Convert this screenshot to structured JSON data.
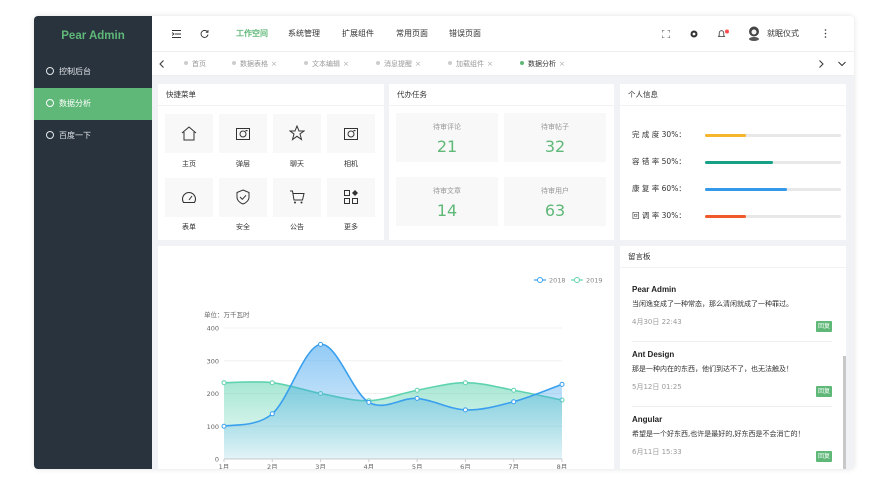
{
  "app": {
    "logo": "Pear Admin"
  },
  "sidebar": {
    "items": [
      {
        "label": "控制后台"
      },
      {
        "label": "数据分析"
      },
      {
        "label": "百度一下"
      }
    ]
  },
  "header": {
    "nav": [
      "工作空间",
      "系统管理",
      "扩展组件",
      "常用页面",
      "错误页面"
    ],
    "user": "就眠仪式",
    "icons": [
      "menu-fold-icon",
      "refresh-icon",
      "fullscreen-icon",
      "theme-icon",
      "bell-icon",
      "avatar",
      "more-icon"
    ]
  },
  "tabs": {
    "items": [
      "首页",
      "数据表格",
      "文本编辑",
      "消息提醒",
      "加载组件",
      "数据分析"
    ]
  },
  "quick_menu": {
    "title": "快捷菜单",
    "items": [
      {
        "label": "主页",
        "icon": "home-icon"
      },
      {
        "label": "弹层",
        "icon": "camera-icon"
      },
      {
        "label": "聊天",
        "icon": "star-icon"
      },
      {
        "label": "相机",
        "icon": "camera-icon"
      },
      {
        "label": "表单",
        "icon": "gauge-icon"
      },
      {
        "label": "安全",
        "icon": "shield-icon"
      },
      {
        "label": "公告",
        "icon": "cart-icon"
      },
      {
        "label": "更多",
        "icon": "apps-icon"
      }
    ]
  },
  "tasks": {
    "title": "代办任务",
    "items": [
      {
        "label": "待审评论",
        "value": "21"
      },
      {
        "label": "待审帖子",
        "value": "32"
      },
      {
        "label": "待审文章",
        "value": "14"
      },
      {
        "label": "待审用户",
        "value": "63"
      }
    ]
  },
  "profile": {
    "title": "个人信息",
    "rows": [
      {
        "label": "完 成 度 30%：",
        "value": 0.3,
        "color": "#f5b62b"
      },
      {
        "label": "容 错 率 50%：",
        "value": 0.5,
        "color": "#16a085"
      },
      {
        "label": "康 复 率 60%：",
        "value": 0.6,
        "color": "#3399e8"
      },
      {
        "label": "回 调 率 30%：",
        "value": 0.3,
        "color": "#f05a2a"
      }
    ]
  },
  "messages": {
    "title": "留言板",
    "reply_label": "回复",
    "items": [
      {
        "title": "Pear Admin",
        "content": "当闲逸变成了一种常态，那么清闲就成了一种罪过。",
        "date": "4月30日 22:43"
      },
      {
        "title": "Ant Design",
        "content": "那是一种内在的东西，他们到达不了，也无法触及！",
        "date": "5月12日 01:25"
      },
      {
        "title": "Angular",
        "content": "希望是一个好东西,也许是最好的,好东西是不会消亡的！",
        "date": "6月11日 15:33"
      }
    ]
  },
  "chart_data": {
    "type": "area",
    "unit_label": "单位：万千瓦时",
    "categories": [
      "1月",
      "2月",
      "3月",
      "4月",
      "5月",
      "6月",
      "7月",
      "8月"
    ],
    "ylim": [
      0,
      400
    ],
    "yticks": [
      0,
      100,
      200,
      300,
      400
    ],
    "series": [
      {
        "name": "2018",
        "values": [
          100,
          138,
          350,
          173,
          185,
          150,
          175,
          228
        ],
        "color": "#3aa0ee"
      },
      {
        "name": "2019",
        "values": [
          233,
          233,
          200,
          178,
          210,
          233,
          210,
          180
        ],
        "color": "#5fd3b0"
      }
    ],
    "legend": "top-right"
  }
}
